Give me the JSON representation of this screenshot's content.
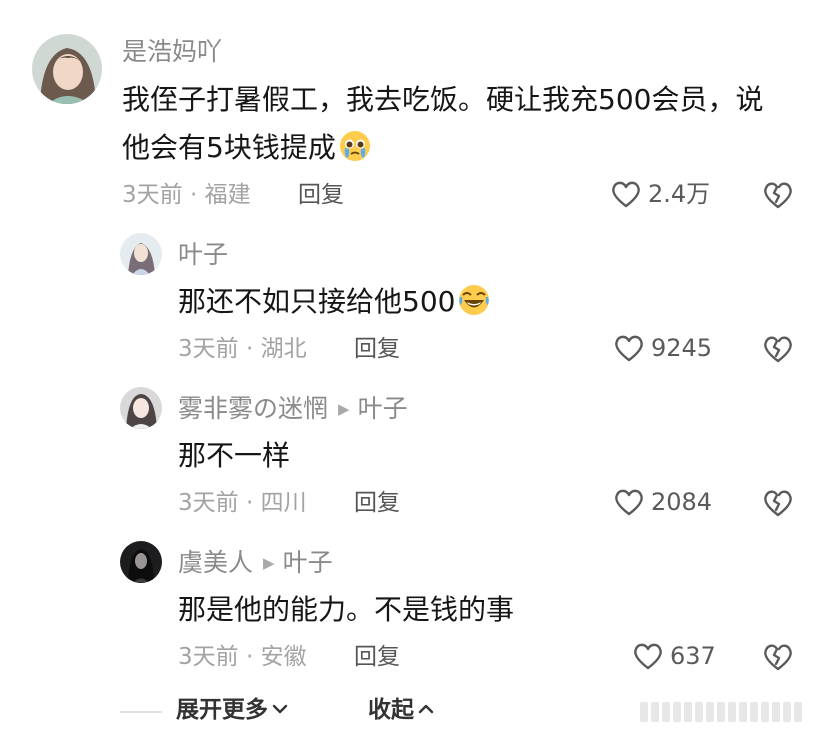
{
  "comments": [
    {
      "user": "是浩妈吖",
      "text_line1": "我侄子打暑假工，我去吃饭。硬让我充500会员，说",
      "text_line2": "他会有5块钱提成",
      "emoji": "pleading-tears-emoji",
      "meta": "3天前 · 福建",
      "reply_label": "回复",
      "likes": "2.4万"
    },
    {
      "user": "叶子",
      "text": "那还不如只接给他500",
      "emoji": "rofl-emoji",
      "meta": "3天前 · 湖北",
      "reply_label": "回复",
      "likes": "9245"
    },
    {
      "user": "雾非雾の迷惘",
      "reply_to": "叶子",
      "text": "那不一样",
      "meta": "3天前 · 四川",
      "reply_label": "回复",
      "likes": "2084"
    },
    {
      "user": "虞美人",
      "reply_to": "叶子",
      "text": "那是他的能力。不是钱的事",
      "meta": "3天前 · 安徽",
      "reply_label": "回复",
      "likes": "637"
    }
  ],
  "footer": {
    "expand_more": "展开更多",
    "collapse": "收起"
  },
  "colors": {
    "text": "#161616",
    "meta": "#a3a3a3",
    "name": "#8a8a8a",
    "icon": "#5a5a5a"
  }
}
